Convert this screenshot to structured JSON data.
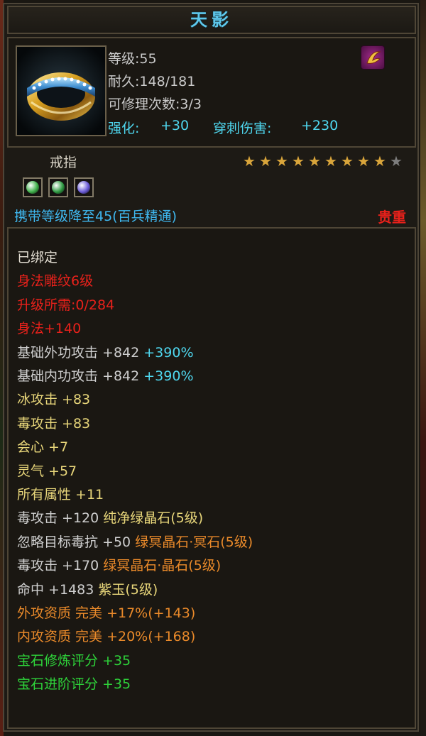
{
  "item": {
    "name": "天影",
    "level": "等级:55",
    "durability": "耐久:148/181",
    "repair_count": "可修理次数:3/3",
    "enhance_label": "强化:",
    "enhance_value": "+30",
    "pierce_label": "穿刺伤害:",
    "pierce_value": "+230",
    "type": "戒指",
    "stars_filled": 9,
    "stars_total": 10,
    "star_glyph": "★",
    "carry_level": "携带等级降至45(百兵精通)",
    "rarity": "贵重",
    "icon": "gold-ring-icon",
    "badge_icon": "martial-class-badge-icon"
  },
  "gems": [
    {
      "icon": "green-gem-icon",
      "color": "#3fb04a"
    },
    {
      "icon": "green-gem-icon",
      "color": "#2e9a42"
    },
    {
      "icon": "purple-gem-icon",
      "color": "#6a5ad8"
    }
  ],
  "stats": [
    {
      "parts": [
        {
          "t": "已绑定",
          "c": "w"
        }
      ]
    },
    {
      "parts": [
        {
          "t": "身法雕纹6级",
          "c": "red"
        }
      ]
    },
    {
      "parts": [
        {
          "t": "升级所需:0/284",
          "c": "red"
        }
      ]
    },
    {
      "parts": [
        {
          "t": "身法+140",
          "c": "red"
        }
      ]
    },
    {
      "parts": [
        {
          "t": "基础外功攻击 +842 ",
          "c": "wh"
        },
        {
          "t": "+390%",
          "c": "cy"
        }
      ]
    },
    {
      "parts": [
        {
          "t": "基础内功攻击 +842 ",
          "c": "wh"
        },
        {
          "t": "+390%",
          "c": "cy"
        }
      ]
    },
    {
      "parts": [
        {
          "t": "冰攻击 +83",
          "c": "yl"
        }
      ]
    },
    {
      "parts": [
        {
          "t": "毒攻击 +83",
          "c": "yl"
        }
      ]
    },
    {
      "parts": [
        {
          "t": "会心 +7",
          "c": "yl"
        }
      ]
    },
    {
      "parts": [
        {
          "t": "灵气 +57",
          "c": "yl"
        }
      ]
    },
    {
      "parts": [
        {
          "t": "所有属性 +11",
          "c": "yl"
        }
      ]
    },
    {
      "parts": [
        {
          "t": "毒攻击 +120 ",
          "c": "wh"
        },
        {
          "t": "纯净绿晶石(5级)",
          "c": "yl"
        }
      ]
    },
    {
      "parts": [
        {
          "t": "忽略目标毒抗 +50 ",
          "c": "wh"
        },
        {
          "t": "绿冥晶石·冥石(5级)",
          "c": "or"
        }
      ]
    },
    {
      "parts": [
        {
          "t": "毒攻击 +170 ",
          "c": "wh"
        },
        {
          "t": "绿冥晶石·晶石(5级)",
          "c": "or"
        }
      ]
    },
    {
      "parts": [
        {
          "t": "命中 +1483 ",
          "c": "wh"
        },
        {
          "t": "紫玉(5级)",
          "c": "yl"
        }
      ]
    },
    {
      "parts": [
        {
          "t": "外攻资质  完美 +17%(+143)",
          "c": "or"
        }
      ]
    },
    {
      "parts": [
        {
          "t": "内攻资质  完美 +20%(+168)",
          "c": "or"
        }
      ]
    },
    {
      "parts": [
        {
          "t": "宝石修炼评分 +35",
          "c": "gr"
        }
      ]
    },
    {
      "parts": [
        {
          "t": "宝石进阶评分 +35",
          "c": "gr"
        }
      ]
    }
  ]
}
